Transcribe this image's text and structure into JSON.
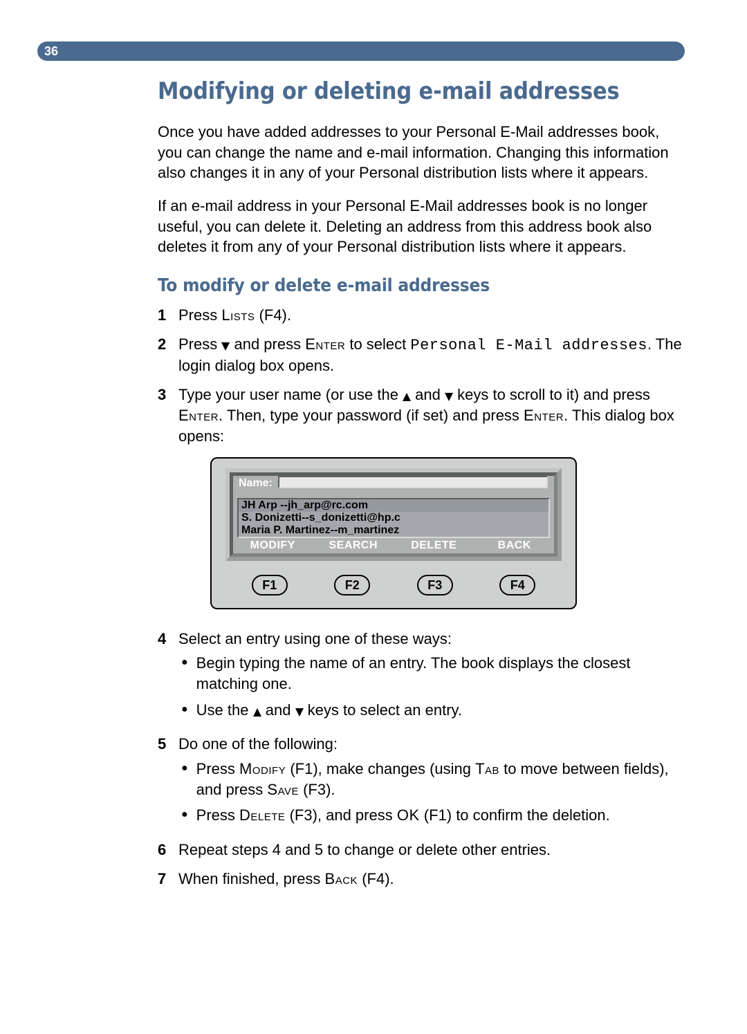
{
  "page_number": "36",
  "heading": "Modifying or deleting e-mail addresses",
  "para1": "Once you have added addresses to your Personal E-Mail addresses book, you can change the name and e-mail information. Changing this information also changes it in any of your Personal distribution lists where it appears.",
  "para2": "If an e-mail address in your Personal E-Mail addresses book is no longer useful, you can delete it. Deleting an address from this address book also deletes it from any of your Personal distribution lists where it appears.",
  "subheading": "To modify or delete e-mail addresses",
  "steps": {
    "s1": {
      "num": "1",
      "pre": "Press ",
      "key": "Lists",
      "post": " (F4)."
    },
    "s2": {
      "num": "2",
      "pre": "Press ",
      "mid": " and press ",
      "key": "Enter",
      "mid2": " to select ",
      "target": "Personal E-Mail addresses",
      "post": ". The login dialog box opens."
    },
    "s3": {
      "num": "3",
      "pre": "Type your user name (or use the ",
      "mid": " and ",
      "mid2": " keys to scroll to it) and press ",
      "key1": "Enter",
      "mid3": ". Then, type your password (if set) and press ",
      "key2": "Enter",
      "post": ". This dialog box opens:"
    },
    "s4": {
      "num": "4",
      "text": "Select an entry using one of these ways:",
      "b1": "Begin typing the name of an entry. The book displays the closest matching one.",
      "b2_pre": "Use the ",
      "b2_mid": " and ",
      "b2_post": " keys to select an entry."
    },
    "s5": {
      "num": "5",
      "text": "Do one of the following:",
      "b1_pre": "Press ",
      "b1_k1": "Modify",
      "b1_mid1": " (F1), make changes (using ",
      "b1_k2": "Tab",
      "b1_mid2": " to move between fields), and press ",
      "b1_k3": "Save",
      "b1_post": " (F3).",
      "b2_pre": "Press ",
      "b2_k1": "Delete",
      "b2_mid1": " (F3), and press ",
      "b2_k2": "OK",
      "b2_post": " (F1) to confirm the deletion."
    },
    "s6": {
      "num": "6",
      "text": "Repeat steps 4 and 5 to change or delete other entries."
    },
    "s7": {
      "num": "7",
      "pre": "When finished, press ",
      "key": "Back",
      "post": " (F4)."
    }
  },
  "device": {
    "name_label": "Name:",
    "rows": [
      "JH Arp --jh_arp@rc.com",
      "S. Donizetti--s_donizetti@hp.c",
      "Maria P. Martinez--m_martinez"
    ],
    "softkeys": [
      "MODIFY",
      "SEARCH",
      "DELETE",
      "BACK"
    ],
    "fkeys": [
      "F1",
      "F2",
      "F3",
      "F4"
    ]
  }
}
